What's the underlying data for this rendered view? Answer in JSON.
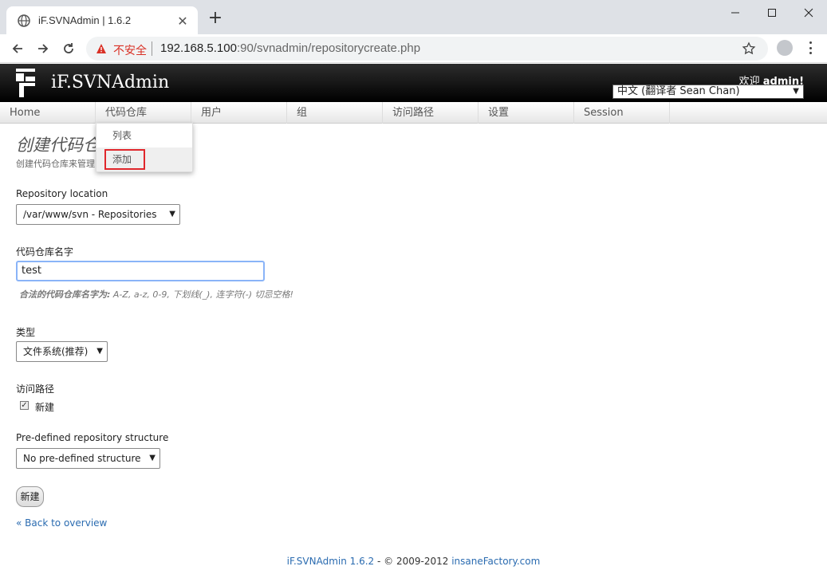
{
  "browser": {
    "tab_title": "iF.SVNAdmin | 1.6.2",
    "insecure_label": "不安全",
    "url_host": "192.168.5.100",
    "url_path": ":90/svnadmin/repositorycreate.php"
  },
  "header": {
    "app_title": "iF.SVNAdmin",
    "welcome_prefix": "欢迎",
    "welcome_user": "admin!",
    "language": "中文 (翻译者 Sean Chan)"
  },
  "nav": {
    "items": [
      "Home",
      "代码仓库",
      "用户",
      "组",
      "访问路径",
      "设置",
      "Session"
    ],
    "dropdown": [
      "列表",
      "添加"
    ]
  },
  "main": {
    "title": "创建代码仓库",
    "description": "创建代码仓库来管理",
    "location_label": "Repository location",
    "location_value": "/var/www/svn - Repositories",
    "name_label": "代码仓库名字",
    "name_value": "test",
    "hint_bold": "合法的代码仓库名字为:",
    "hint_text": " A-Z, a-z, 0-9, 下划线(_), 连字符(-) 切忌空格!",
    "type_label": "类型",
    "type_value": "文件系统(推荐)",
    "access_label": "访问路径",
    "access_checkbox_label": "新建",
    "structure_label": "Pre-defined repository structure",
    "structure_value": "No pre-defined structure",
    "submit_label": "新建",
    "back_link": "« Back to overview"
  },
  "footer": {
    "product": "iF.SVNAdmin 1.6.2",
    "sep": " - © 2009-2012 ",
    "company": "insaneFactory.com"
  },
  "colors": {
    "highlight": "#e0272c",
    "link": "#2a6bb0",
    "insecure": "#d93025"
  }
}
